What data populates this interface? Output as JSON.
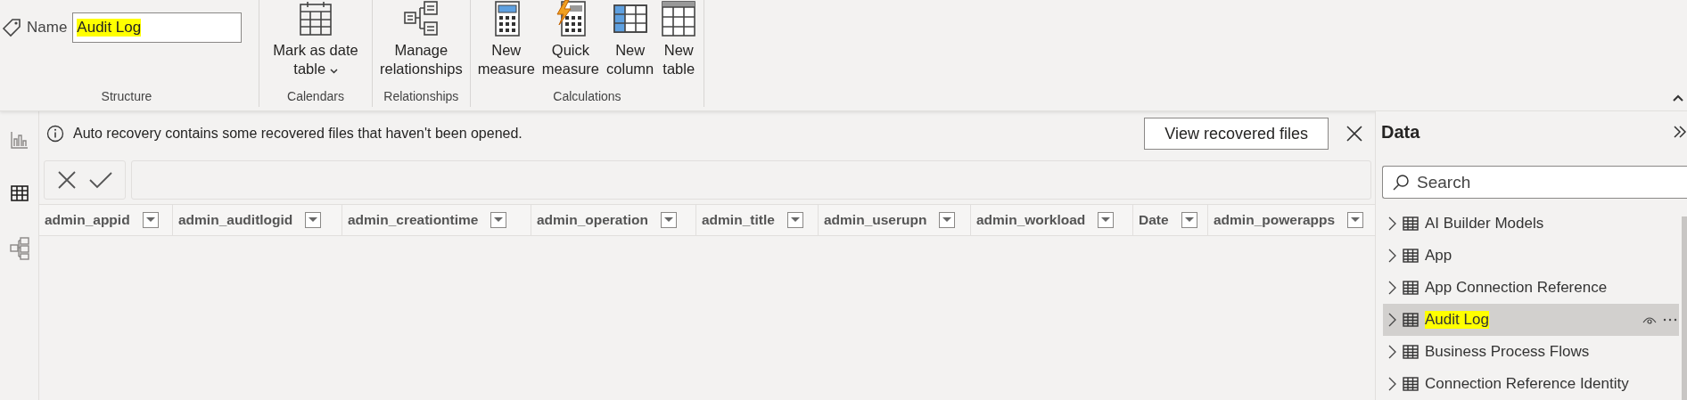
{
  "ribbon": {
    "name_field": {
      "label": "Name",
      "value": "Audit Log",
      "highlighted": true
    },
    "groups": [
      {
        "label": "Structure",
        "kind": "name"
      },
      {
        "label": "Calendars",
        "kind": "buttons",
        "buttons": [
          {
            "label": "Mark as date table",
            "kind": "calendar",
            "dropdown": true
          }
        ]
      },
      {
        "label": "Relationships",
        "kind": "buttons",
        "buttons": [
          {
            "label": "Manage relationships",
            "kind": "relationships",
            "dropdown": false
          }
        ]
      },
      {
        "label": "Calculations",
        "kind": "buttons",
        "buttons": [
          {
            "label": "New measure",
            "kind": "measure",
            "dropdown": false
          },
          {
            "label": "Quick measure",
            "kind": "quick-measure",
            "dropdown": false
          },
          {
            "label": "New column",
            "kind": "column",
            "dropdown": false
          },
          {
            "label": "New table",
            "kind": "table",
            "dropdown": false
          }
        ]
      }
    ]
  },
  "rail": [
    {
      "kind": "report",
      "selected": false
    },
    {
      "kind": "table",
      "selected": true
    },
    {
      "kind": "model",
      "selected": false
    }
  ],
  "notification": {
    "message": "Auto recovery contains some recovered files that haven't been opened.",
    "button": "View recovered files"
  },
  "table": {
    "columns": [
      "admin_appid",
      "admin_auditlogid",
      "admin_creationtime",
      "admin_operation",
      "admin_title",
      "admin_userupn",
      "admin_workload",
      "Date",
      "admin_powerapps"
    ]
  },
  "data_pane": {
    "title": "Data",
    "search": {
      "placeholder": "Search"
    },
    "items": [
      {
        "label": "AI Builder Models",
        "selected": false,
        "highlighted": false
      },
      {
        "label": "App",
        "selected": false,
        "highlighted": false
      },
      {
        "label": "App Connection Reference",
        "selected": false,
        "highlighted": false
      },
      {
        "label": "Audit Log",
        "selected": true,
        "highlighted": true
      },
      {
        "label": "Business Process Flows",
        "selected": false,
        "highlighted": false
      },
      {
        "label": "Connection Reference Identity",
        "selected": false,
        "highlighted": false
      }
    ]
  }
}
